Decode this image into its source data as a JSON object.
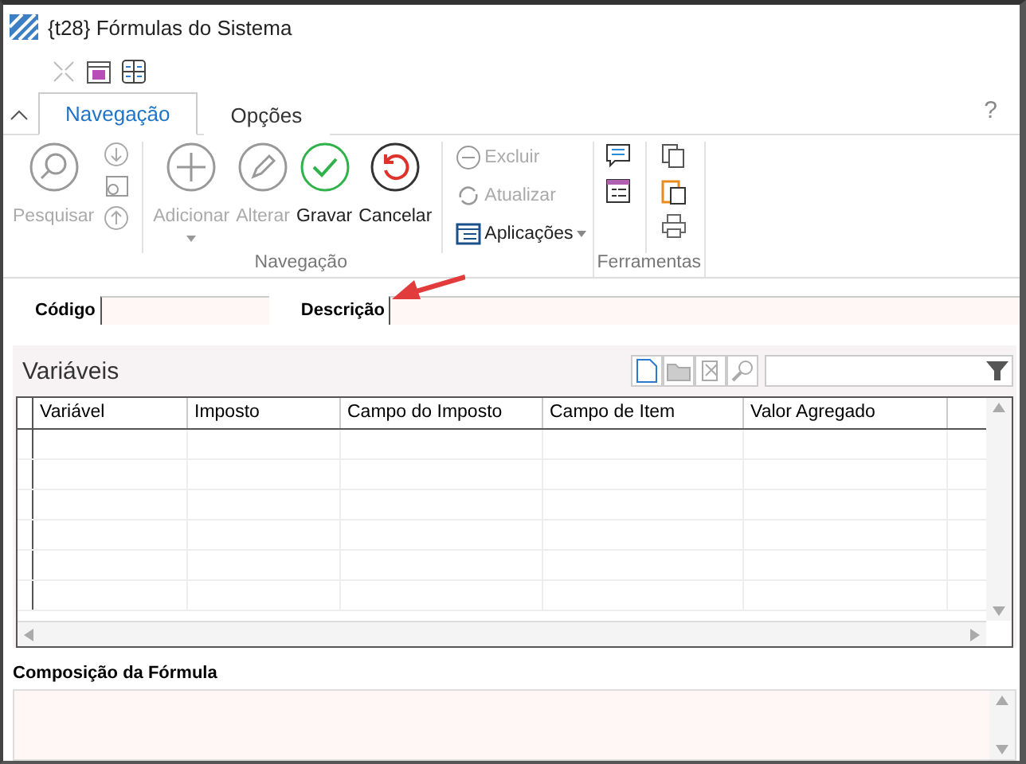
{
  "window": {
    "title": "{t28}  Fórmulas do Sistema"
  },
  "tabs": [
    {
      "label": "Navegação",
      "selected": true
    },
    {
      "label": "Opções",
      "selected": false
    }
  ],
  "help": "?",
  "ribbon": {
    "groups": [
      {
        "label": "Navegação",
        "large_buttons": [
          {
            "kind": "search",
            "label": "Pesquisar",
            "disabled": true
          },
          {
            "kind": "add",
            "label": "Adicionar",
            "disabled": true
          },
          {
            "kind": "edit",
            "label": "Alterar",
            "disabled": true
          },
          {
            "kind": "save",
            "label": "Gravar",
            "disabled": false
          },
          {
            "kind": "cancel",
            "label": "Cancelar",
            "disabled": false
          }
        ],
        "small_buttons": [
          {
            "kind": "delete",
            "label": "Excluir",
            "disabled": true
          },
          {
            "kind": "refresh",
            "label": "Atualizar",
            "disabled": true
          },
          {
            "kind": "apps",
            "label": "Aplicações",
            "disabled": false
          }
        ]
      },
      {
        "label": "Ferramentas"
      }
    ]
  },
  "fields": [
    {
      "label": "Código"
    },
    {
      "label": "Descrição"
    }
  ],
  "variables": {
    "title": "Variáveis",
    "columns": [
      "Variável",
      "Imposto",
      "Campo do Imposto",
      "Campo de Item",
      "Valor Agregado"
    ]
  },
  "formula": {
    "label": "Composição da Fórmula"
  }
}
